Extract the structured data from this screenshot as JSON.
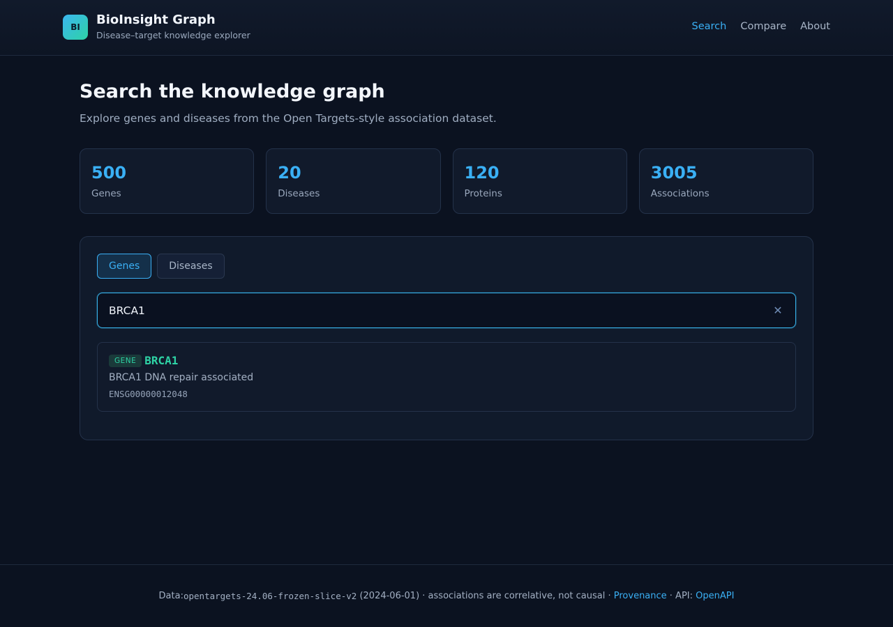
{
  "header": {
    "logo_text": "BI",
    "title": "BioInsight Graph",
    "subtitle": "Disease–target knowledge explorer",
    "nav": [
      {
        "label": "Search"
      },
      {
        "label": "Compare"
      },
      {
        "label": "About"
      }
    ]
  },
  "main": {
    "title": "Search the knowledge graph",
    "subtitle": "Explore genes and diseases from the Open Targets-style association dataset.",
    "stats": [
      {
        "value": "500",
        "label": "Genes"
      },
      {
        "value": "20",
        "label": "Diseases"
      },
      {
        "value": "120",
        "label": "Proteins"
      },
      {
        "value": "3005",
        "label": "Associations"
      }
    ],
    "tabs": [
      {
        "label": "Genes"
      },
      {
        "label": "Diseases"
      }
    ],
    "search": {
      "value": "BRCA1",
      "clear_icon": "close-icon"
    },
    "result": {
      "badge": "GENE",
      "symbol": "BRCA1",
      "description": "BRCA1 DNA repair associated",
      "id": "ENSG00000012048"
    }
  },
  "footer": {
    "prefix": "Data: ",
    "dataset": "opentargets-24.06-frozen-slice-v2",
    "middle": " (2024-06-01) · associations are correlative, not causal · ",
    "provenance_link": "Provenance",
    "api_prefix": " · API: ",
    "api_link": "OpenAPI"
  },
  "colors": {
    "accent": "#3ab0f5",
    "gene_green": "#2ed3a5",
    "background": "#0b1220"
  }
}
